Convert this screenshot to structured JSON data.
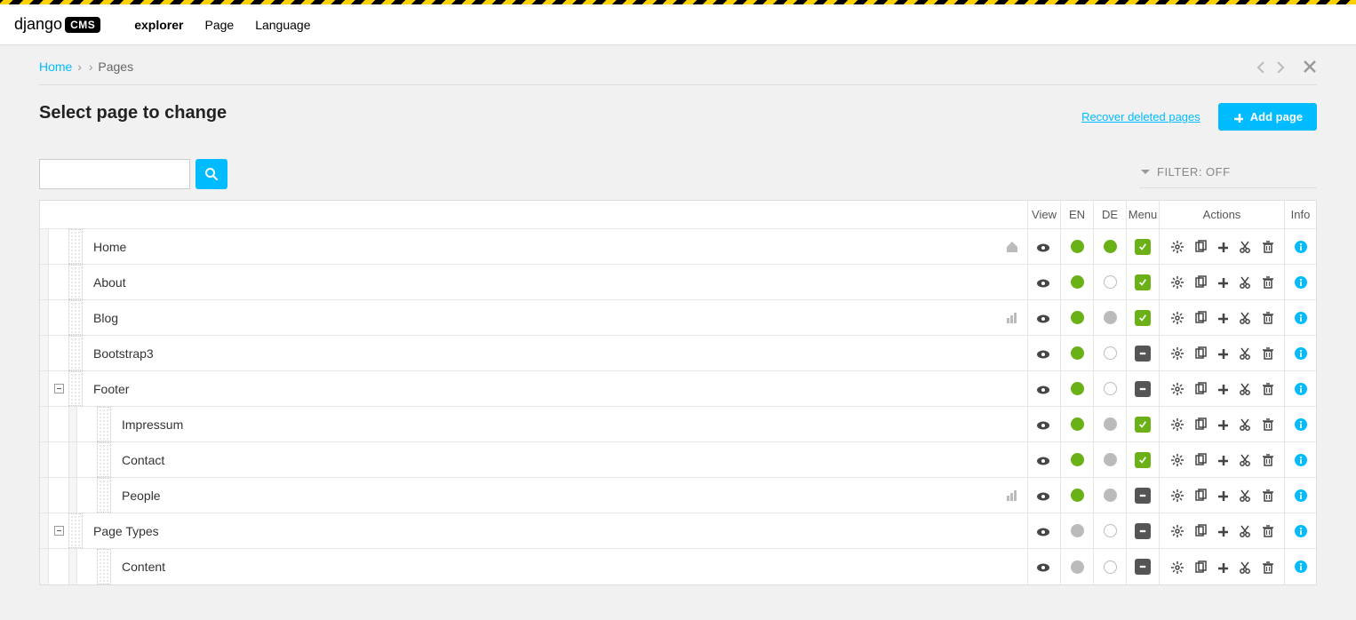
{
  "toolbar": {
    "brand_prefix": "django",
    "brand_suffix": "CMS",
    "items": [
      {
        "label": "explorer",
        "bold": true
      },
      {
        "label": "Page"
      },
      {
        "label": "Language"
      }
    ]
  },
  "breadcrumb": {
    "home": "Home",
    "items": [
      "",
      "Pages"
    ]
  },
  "heading": "Select page to change",
  "actions": {
    "recover": "Recover deleted pages",
    "add": "Add page"
  },
  "filter": {
    "label": "FILTER: OFF"
  },
  "search": {
    "value": ""
  },
  "headers": {
    "view": "View",
    "en": "EN",
    "de": "DE",
    "menu": "Menu",
    "actions": "Actions",
    "info": "Info"
  },
  "pages": [
    {
      "depth": 0,
      "title": "Home",
      "expand": "",
      "right_icon": "home",
      "view": true,
      "en": "green",
      "de": "green",
      "menu": "check"
    },
    {
      "depth": 0,
      "title": "About",
      "expand": "",
      "right_icon": "",
      "view": true,
      "en": "green",
      "de": "empty",
      "menu": "check"
    },
    {
      "depth": 0,
      "title": "Blog",
      "expand": "",
      "right_icon": "chart",
      "view": true,
      "en": "green",
      "de": "grey",
      "menu": "check"
    },
    {
      "depth": 0,
      "title": "Bootstrap3",
      "expand": "",
      "right_icon": "",
      "view": true,
      "en": "green",
      "de": "empty",
      "menu": "dash"
    },
    {
      "depth": 0,
      "title": "Footer",
      "expand": "minus",
      "right_icon": "",
      "view": true,
      "en": "green",
      "de": "empty",
      "menu": "dash"
    },
    {
      "depth": 1,
      "title": "Impressum",
      "expand": "",
      "right_icon": "",
      "view": true,
      "en": "green",
      "de": "grey",
      "menu": "check"
    },
    {
      "depth": 1,
      "title": "Contact",
      "expand": "",
      "right_icon": "",
      "view": true,
      "en": "green",
      "de": "grey",
      "menu": "check"
    },
    {
      "depth": 1,
      "title": "People",
      "expand": "",
      "right_icon": "chart",
      "view": true,
      "en": "green",
      "de": "grey",
      "menu": "dash"
    },
    {
      "depth": 0,
      "title": "Page Types",
      "expand": "minus",
      "right_icon": "",
      "view": true,
      "en": "grey",
      "de": "empty",
      "menu": "dash"
    },
    {
      "depth": 1,
      "title": "Content",
      "expand": "",
      "right_icon": "",
      "view": true,
      "en": "grey",
      "de": "empty",
      "menu": "dash"
    }
  ]
}
